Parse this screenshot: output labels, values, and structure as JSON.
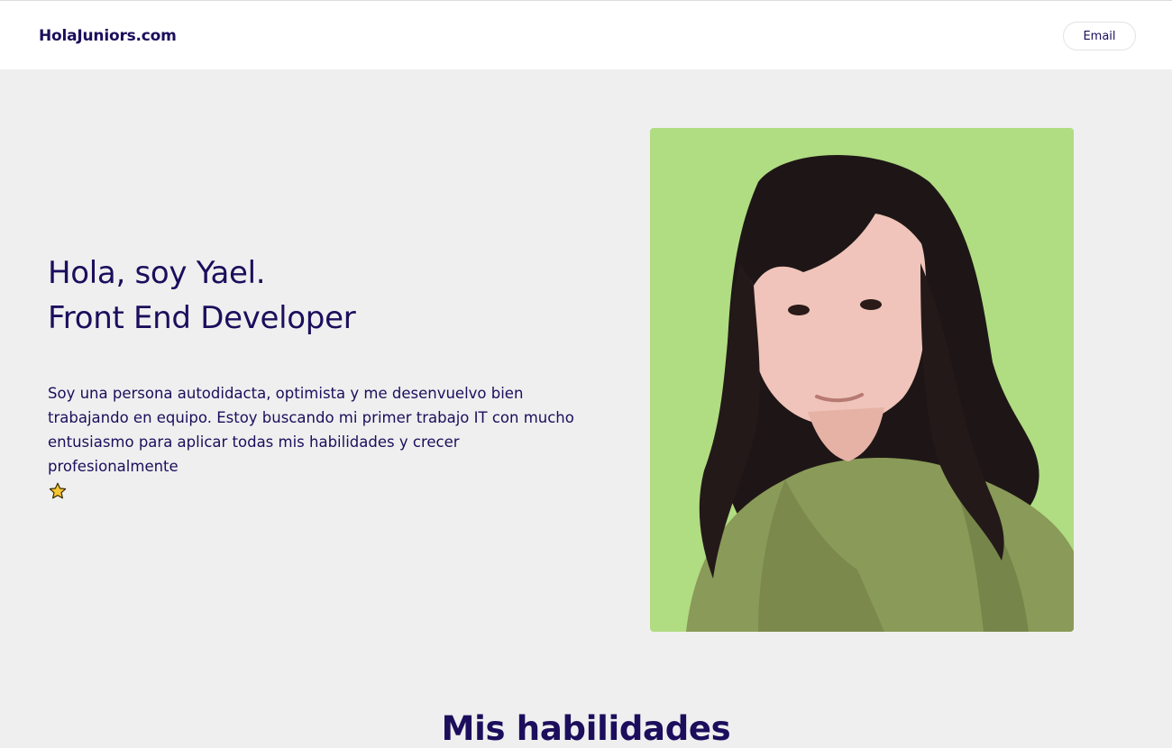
{
  "header": {
    "brand": "HolaJuniors.com",
    "email_button": "Email"
  },
  "hero": {
    "title_line1": "Hola, soy Yael.",
    "title_line2": "Front End Developer",
    "description": "Soy una persona autodidacta, optimista y me desenvuelvo bien trabajando en equipo. Estoy buscando mi primer trabajo IT con mucho entusiasmo para aplicar todas mis habilidades y crecer profesionalmente",
    "emoji_icon": "star-icon",
    "photo_background": "#b0dc82"
  },
  "skills": {
    "title": "Mis habilidades"
  },
  "colors": {
    "text": "#1c0e5c",
    "page_background": "#efefef",
    "header_background": "#ffffff",
    "star_fill": "#f7c531"
  }
}
